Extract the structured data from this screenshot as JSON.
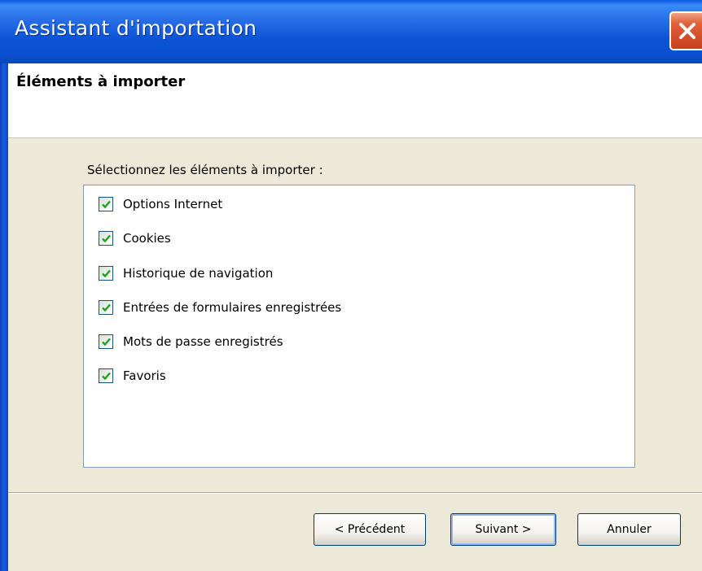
{
  "window": {
    "title": "Assistant d'importation"
  },
  "header": {
    "heading": "Éléments à importer"
  },
  "body": {
    "instruction": "Sélectionnez les éléments à importer :",
    "items": [
      {
        "label": "Options Internet",
        "checked": true
      },
      {
        "label": "Cookies",
        "checked": true
      },
      {
        "label": "Historique de navigation",
        "checked": true
      },
      {
        "label": "Entrées de formulaires enregistrées",
        "checked": true
      },
      {
        "label": "Mots de passe enregistrés",
        "checked": true
      },
      {
        "label": "Favoris",
        "checked": true
      }
    ]
  },
  "footer": {
    "prev_label": "< Précédent",
    "next_label": "Suivant >",
    "cancel_label": "Annuler"
  },
  "colors": {
    "titlebar": "#0a55d8",
    "checkmark": "#21a121",
    "dialog_bg": "#ece9d8"
  }
}
